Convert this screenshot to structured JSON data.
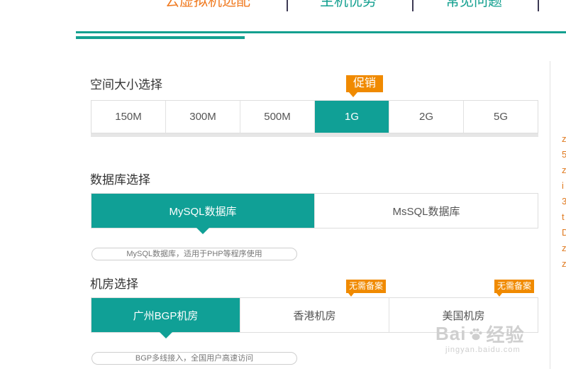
{
  "nav": {
    "tabs": [
      {
        "label": "云虚拟机选配",
        "color": "#f07a20"
      },
      {
        "label": "主机优势",
        "color": "#14a090"
      },
      {
        "label": "常见问题",
        "color": "#14a090"
      }
    ]
  },
  "size_section": {
    "title": "空间大小选择",
    "promo": "促销",
    "options": [
      "150M",
      "300M",
      "500M",
      "1G",
      "2G",
      "5G"
    ],
    "selected": "1G"
  },
  "db_section": {
    "title": "数据库选择",
    "options": [
      "MySQL数据库",
      "MsSQL数据库"
    ],
    "selected": "MySQL数据库",
    "hint": "MySQL数据库，适用于PHP等程序使用"
  },
  "room_section": {
    "title": "机房选择",
    "options": [
      "广州BGP机房",
      "香港机房",
      "美国机房"
    ],
    "selected": "广州BGP机房",
    "badge": "无需备案",
    "hint": "BGP多线接入，全国用户高速访问"
  },
  "side_text": [
    "z",
    "5",
    "z",
    "i",
    "3",
    "t",
    "D",
    "",
    "z",
    "",
    "z"
  ],
  "watermark": {
    "main_left": "Bai",
    "main_right": "经验",
    "sub": "jingyan.baidu.com"
  },
  "colors": {
    "teal": "#10a096",
    "orange": "#f08a00",
    "nav_orange": "#f07a20"
  }
}
